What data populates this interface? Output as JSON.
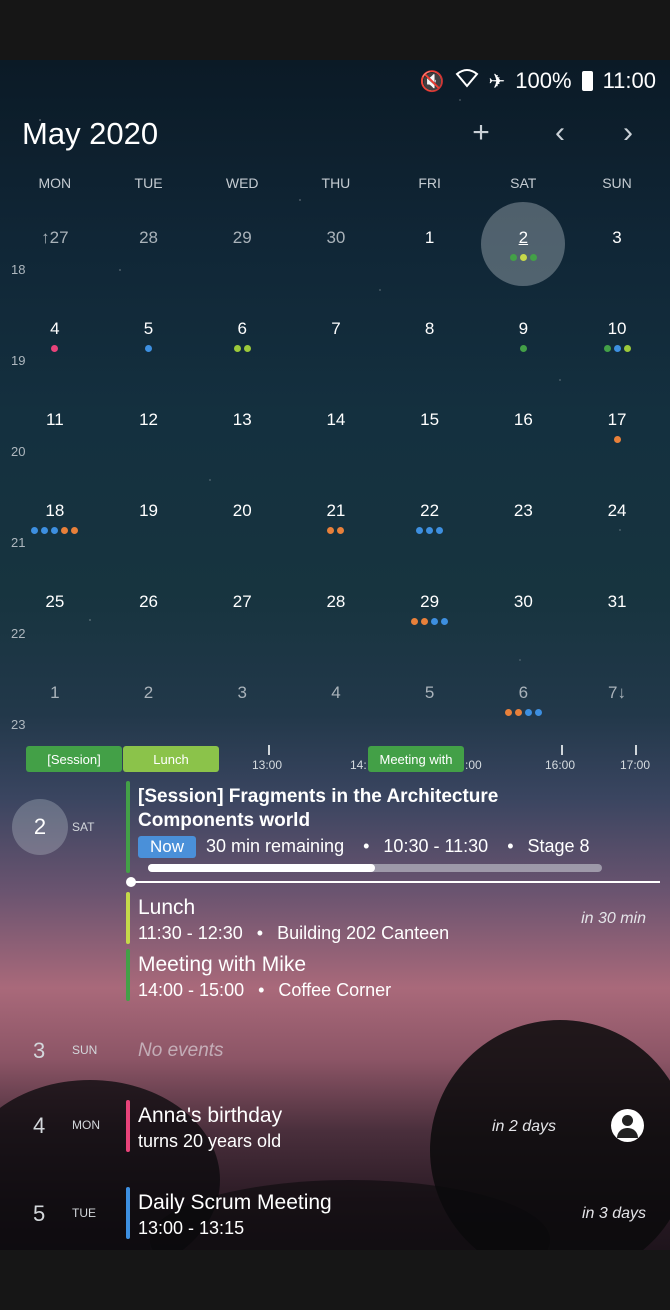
{
  "status_bar": {
    "battery": "100%",
    "time": "11:00",
    "icons": [
      "mute-icon",
      "wifi-icon",
      "airplane-icon",
      "battery-icon"
    ]
  },
  "header": {
    "title": "May 2020",
    "add_label": "+",
    "prev_label": "‹",
    "next_label": "›"
  },
  "weekdays": [
    "MON",
    "TUE",
    "WED",
    "THU",
    "FRI",
    "SAT",
    "SUN"
  ],
  "weeks": [
    {
      "week": "18",
      "days": [
        {
          "n": "↑27",
          "dim": true,
          "dots": []
        },
        {
          "n": "28",
          "dim": true,
          "dots": []
        },
        {
          "n": "29",
          "dim": true,
          "dots": []
        },
        {
          "n": "30",
          "dim": true,
          "dots": []
        },
        {
          "n": "1",
          "dots": []
        },
        {
          "n": "2",
          "today": true,
          "dots": [
            "#43a047",
            "#c5d94a",
            "#43a047"
          ]
        },
        {
          "n": "3",
          "dots": []
        }
      ]
    },
    {
      "week": "19",
      "days": [
        {
          "n": "4",
          "dots": [
            "#e8437a"
          ]
        },
        {
          "n": "5",
          "dots": [
            "#3d8fe0"
          ]
        },
        {
          "n": "6",
          "dots": [
            "#9cc93a",
            "#9cc93a"
          ]
        },
        {
          "n": "7",
          "dots": []
        },
        {
          "n": "8",
          "dots": []
        },
        {
          "n": "9",
          "dots": [
            "#43a047"
          ]
        },
        {
          "n": "10",
          "dots": [
            "#43a047",
            "#3d8fe0",
            "#9cc93a"
          ]
        }
      ]
    },
    {
      "week": "20",
      "days": [
        {
          "n": "11",
          "dots": []
        },
        {
          "n": "12",
          "dots": []
        },
        {
          "n": "13",
          "dots": []
        },
        {
          "n": "14",
          "dots": []
        },
        {
          "n": "15",
          "dots": []
        },
        {
          "n": "16",
          "dots": []
        },
        {
          "n": "17",
          "dots": [
            "#e8803a"
          ]
        }
      ]
    },
    {
      "week": "21",
      "days": [
        {
          "n": "18",
          "dots": [
            "#3d8fe0",
            "#3d8fe0",
            "#3d8fe0",
            "#e8803a",
            "#e8803a"
          ]
        },
        {
          "n": "19",
          "dots": []
        },
        {
          "n": "20",
          "dots": []
        },
        {
          "n": "21",
          "dots": [
            "#e8803a",
            "#e8803a"
          ]
        },
        {
          "n": "22",
          "dots": [
            "#3d8fe0",
            "#3d8fe0",
            "#3d8fe0"
          ]
        },
        {
          "n": "23",
          "dots": []
        },
        {
          "n": "24",
          "dots": []
        }
      ]
    },
    {
      "week": "22",
      "days": [
        {
          "n": "25",
          "dots": []
        },
        {
          "n": "26",
          "dots": []
        },
        {
          "n": "27",
          "dots": []
        },
        {
          "n": "28",
          "dots": []
        },
        {
          "n": "29",
          "dots": [
            "#e8803a",
            "#e8803a",
            "#3d8fe0",
            "#3d8fe0"
          ]
        },
        {
          "n": "30",
          "dots": []
        },
        {
          "n": "31",
          "dots": []
        }
      ]
    },
    {
      "week": "23",
      "days": [
        {
          "n": "1",
          "dim": true,
          "dots": []
        },
        {
          "n": "2",
          "dim": true,
          "dots": []
        },
        {
          "n": "3",
          "dim": true,
          "dots": []
        },
        {
          "n": "4",
          "dim": true,
          "dots": []
        },
        {
          "n": "5",
          "dim": true,
          "dots": []
        },
        {
          "n": "6",
          "dim": true,
          "dots": [
            "#e8803a",
            "#e8803a",
            "#3d8fe0",
            "#3d8fe0"
          ]
        },
        {
          "n": "7↓",
          "dim": true,
          "dots": []
        }
      ]
    }
  ],
  "timeline": {
    "ticks": [
      "13:00",
      "14:",
      ":00",
      "16:00",
      "17:00"
    ],
    "blocks": [
      {
        "label": "[Session]",
        "color": "#43a047"
      },
      {
        "label": "Lunch",
        "color": "#8bc34a"
      },
      {
        "label": "Meeting with",
        "color": "#43a047"
      }
    ]
  },
  "agenda": {
    "sat": {
      "num": "2",
      "dow": "SAT"
    },
    "session": {
      "title_line1": "[Session] Fragments in the Architecture",
      "title_line2": "Components world",
      "now": "Now",
      "remaining": "30 min remaining",
      "sep": "•",
      "time": "10:30 - 11:30",
      "location": "Stage 8",
      "progress": 0.5,
      "color": "#43a047"
    },
    "lunch": {
      "title": "Lunch",
      "time": "11:30 - 12:30",
      "location": "Building 202 Canteen",
      "rel": "in 30 min",
      "color": "#c5d94a"
    },
    "meeting": {
      "title": "Meeting with Mike",
      "time": "14:00 - 15:00",
      "location": "Coffee Corner",
      "color": "#43a047"
    },
    "sun": {
      "num": "3",
      "dow": "SUN",
      "empty": "No events"
    },
    "mon": {
      "num": "4",
      "dow": "MON",
      "title": "Anna's birthday",
      "sub": "turns 20 years old",
      "rel": "in 2 days",
      "color": "#e8437a"
    },
    "tue": {
      "num": "5",
      "dow": "TUE",
      "title": "Daily Scrum Meeting",
      "time": "13:00 - 13:15",
      "rel": "in 3 days",
      "color": "#3d8fe0"
    }
  }
}
